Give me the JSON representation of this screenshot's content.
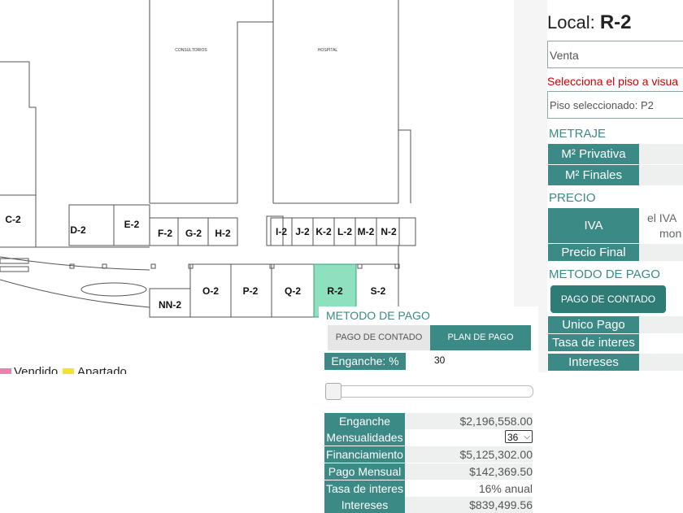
{
  "plan": {
    "building_labels": [
      "CONSULTORIOS",
      "HOSPITAL"
    ],
    "units": [
      "C-2",
      "D-2",
      "E-2",
      "F-2",
      "G-2",
      "H-2",
      "I-2",
      "J-2",
      "K-2",
      "L-2",
      "M-2",
      "N-2",
      "O-2",
      "P-2",
      "Q-2",
      "R-2",
      "S-2",
      "NN-2"
    ],
    "selected_unit": "R-2",
    "selected_color": "#8fe0bf",
    "legend": [
      {
        "label": "Vendido",
        "color": "#f07fb0"
      },
      {
        "label": "Apartado",
        "color": "#f5e22c"
      }
    ]
  },
  "panel": {
    "title_prefix": "Local:",
    "title_unit": "R-2",
    "operation_value": "Venta",
    "floor_prompt": "Selecciona el piso a visua",
    "floor_selected": "Piso seleccionado: P2",
    "metraje_heading": "METRAJE",
    "m2_privativa": "M² Privativa",
    "m2_finales": "M² Finales",
    "precio_heading": "PRECIO",
    "iva_label": "IVA",
    "iva_note_line1": "el IVA",
    "iva_note_line2": "mon",
    "precio_final_label": "Precio Final",
    "metodo_heading": "METODO DE PAGO",
    "pago_contado_button": "PAGO DE CONTADO",
    "unico_pago_label": "Unico Pago",
    "tasa_label": "Tasa de interes",
    "intereses_label": "Intereses"
  },
  "popup": {
    "heading": "METODO DE PAGO",
    "tab_contado": "PAGO DE CONTADO",
    "tab_plan": "PLAN DE PAGO",
    "enganche_pct_label": "Enganche: %",
    "enganche_pct_value": "30",
    "slider_value_fraction": 0.0,
    "rows": {
      "enganche_label": "Enganche",
      "enganche_value": "$2,196,558.00",
      "mensualidades_label": "Mensualidades",
      "mensualidades_value": "36",
      "financiamiento_label": "Financiamiento",
      "financiamiento_value": "$5,125,302.00",
      "pago_mensual_label": "Pago Mensual",
      "pago_mensual_value": "$142,369.50",
      "tasa_label": "Tasa de interes",
      "tasa_value": "16% anual",
      "intereses_label": "Intereses",
      "intereses_value": "$839,499.56"
    }
  }
}
